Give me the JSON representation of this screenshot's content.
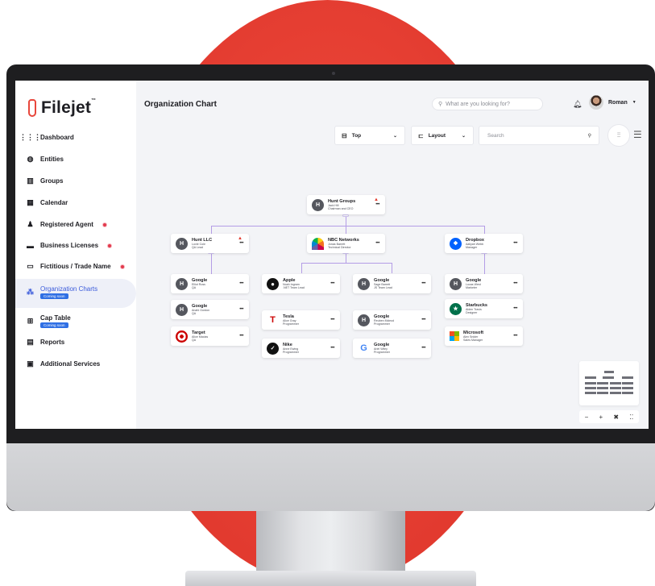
{
  "app": {
    "logo_text": "Filejet",
    "logo_tm": "™"
  },
  "header": {
    "title": "Organization Chart",
    "search_placeholder": "What are you looking for?",
    "user_name": "Roman"
  },
  "sidebar": {
    "items": [
      {
        "label": "Dashboard",
        "icon": "grid-icon",
        "dot": false
      },
      {
        "label": "Entities",
        "icon": "globe-icon",
        "dot": false
      },
      {
        "label": "Groups",
        "icon": "building-icon",
        "dot": false
      },
      {
        "label": "Calendar",
        "icon": "calendar-icon",
        "dot": false
      },
      {
        "label": "Registered Agent",
        "icon": "users-icon",
        "dot": true
      },
      {
        "label": "Business Licenses",
        "icon": "license-icon",
        "dot": true
      },
      {
        "label": "Fictitious / Trade Name",
        "icon": "id-card-icon",
        "dot": true
      },
      {
        "label": "Organization Charts",
        "icon": "org-chart-icon",
        "dot": false,
        "badge": "Coming soon",
        "active": true
      },
      {
        "label": "Cap Table",
        "icon": "table-icon",
        "dot": false,
        "badge": "Coming soon"
      },
      {
        "label": "Reports",
        "icon": "report-icon",
        "dot": false
      },
      {
        "label": "Additional Services",
        "icon": "services-icon",
        "dot": false
      }
    ]
  },
  "toolbar": {
    "direction_label": "Top",
    "layout_label": "Layout",
    "search_placeholder": "Search"
  },
  "org": {
    "root": {
      "name": "Hunt Groups",
      "person": "Jack Hill",
      "role": "Chairman and CEO",
      "logo": "H",
      "warning": true
    },
    "level1": [
      {
        "name": "Hunt LLC",
        "person": "Lovie Cole",
        "role": "QA Lead",
        "logo": "H",
        "warning": true
      },
      {
        "name": "NBC Networks",
        "person": "Jonas Barrett",
        "role": "Technical Director",
        "logo": "nbc"
      },
      {
        "name": "Dropbox",
        "person": "Aaliyah Webb",
        "role": "Manager",
        "logo": "dropbox"
      }
    ],
    "col_hunt": [
      {
        "name": "Google",
        "person": "Elliot Ross",
        "role": "QA",
        "logo": "H"
      },
      {
        "name": "Google",
        "person": "Anahi Gordon",
        "role": "QA",
        "logo": "H"
      },
      {
        "name": "Target",
        "person": "Alice Macias",
        "role": "QA",
        "logo": "target"
      }
    ],
    "col_apple": [
      {
        "name": "Apple",
        "person": "Noah Ingram",
        "role": ".NET Team Lead",
        "logo": "apple"
      },
      {
        "name": "Tesla",
        "person": "Alice Gray",
        "role": "Programmer",
        "logo": "tesla"
      },
      {
        "name": "Nike",
        "person": "Anne Ewing",
        "role": "Programmer",
        "logo": "nike"
      }
    ],
    "col_google": [
      {
        "name": "Google",
        "person": "Sage Barrett",
        "role": "JS Team Lead",
        "logo": "H"
      },
      {
        "name": "Google",
        "person": "Reuben Mcleod",
        "role": "Programmer",
        "logo": "H"
      },
      {
        "name": "Google",
        "person": "Ariel Wiley",
        "role": "Programmer",
        "logo": "google"
      }
    ],
    "col_dropbox": [
      {
        "name": "Google",
        "person": "Lucas West",
        "role": "Marketer",
        "logo": "H"
      },
      {
        "name": "Starbucks",
        "person": "Aiden Travis",
        "role": "Designer",
        "logo": "starbucks"
      },
      {
        "name": "Microsoft",
        "person": "Alex Snider",
        "role": "Sales Manager",
        "logo": "microsoft"
      }
    ]
  },
  "colors": {
    "accent": "#3b5bdb",
    "connector": "#b49de6",
    "warning": "#e23a2f",
    "brand": "#e8473c"
  }
}
